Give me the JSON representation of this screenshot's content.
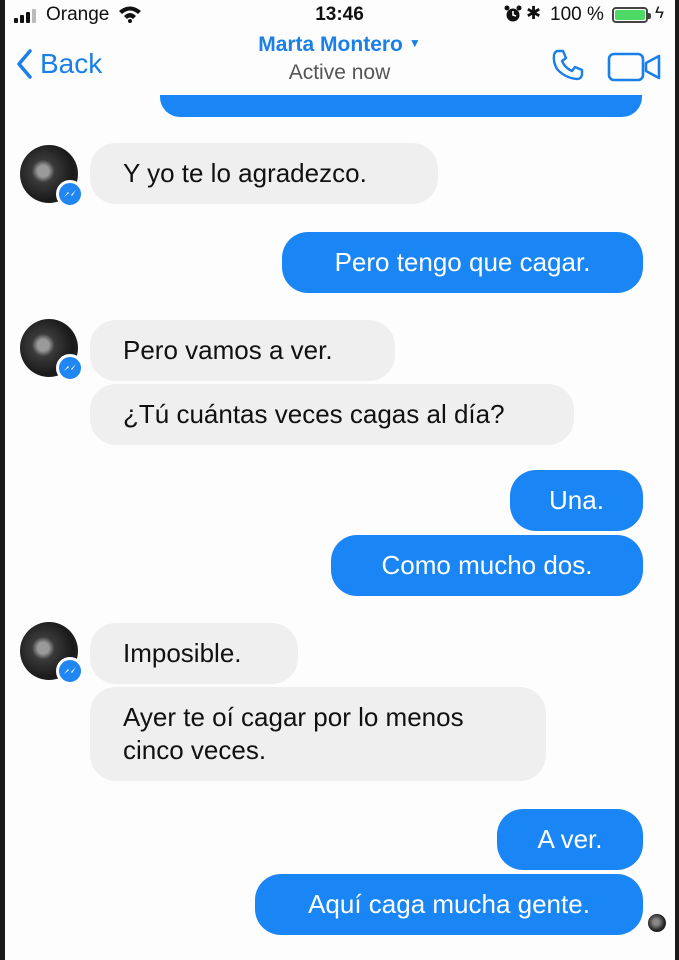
{
  "status_bar": {
    "carrier": "Orange",
    "time": "13:46",
    "battery_percent": "100 %",
    "battery_level": 1.0,
    "icons": [
      "signal-icon",
      "wifi-icon",
      "alarm-icon",
      "bluetooth-icon",
      "battery-icon",
      "charging-icon"
    ]
  },
  "header": {
    "back_label": "Back",
    "contact_name": "Marta Montero",
    "status": "Active now",
    "icons": [
      "chevron-left-icon",
      "phone-icon",
      "video-camera-icon"
    ]
  },
  "messages": [
    {
      "direction": "incoming",
      "text": "Y yo te lo agradezco."
    },
    {
      "direction": "outgoing",
      "text": "Pero tengo que cagar."
    },
    {
      "direction": "incoming",
      "text": "Pero vamos a ver."
    },
    {
      "direction": "incoming",
      "text": "¿Tú cuántas veces cagas al día?"
    },
    {
      "direction": "outgoing",
      "text": "Una."
    },
    {
      "direction": "outgoing",
      "text": "Como mucho dos."
    },
    {
      "direction": "incoming",
      "text": "Imposible."
    },
    {
      "direction": "incoming",
      "text": "Ayer te oí cagar por lo menos cinco veces."
    },
    {
      "direction": "outgoing",
      "text": "A ver."
    },
    {
      "direction": "outgoing",
      "text": "Aquí caga mucha gente."
    }
  ],
  "colors": {
    "accent": "#1a7fe6",
    "outgoing_bubble": "#1a86f5",
    "incoming_bubble": "#efeff0",
    "battery": "#4cd964"
  }
}
